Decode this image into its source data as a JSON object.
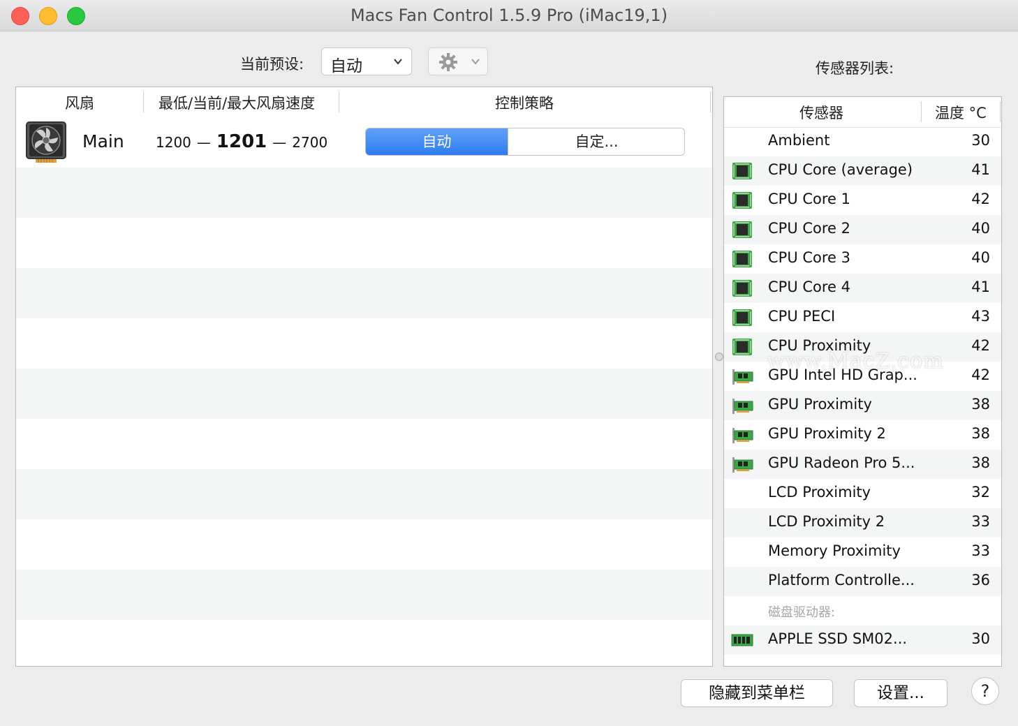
{
  "window": {
    "title": "Macs Fan Control 1.5.9 Pro (iMac19,1)"
  },
  "toolbar": {
    "preset_label": "当前预设:",
    "preset_value": "自动",
    "gear_icon": "gear-icon"
  },
  "fans": {
    "headers": {
      "fan": "风扇",
      "speed": "最低/当前/最大风扇速度",
      "control": "控制策略"
    },
    "rows": [
      {
        "icon": "fan-icon",
        "name": "Main",
        "min": "1200",
        "current": "1201",
        "max": "2700",
        "separator": "—",
        "control_auto": "自动",
        "control_custom": "自定...",
        "selected": "auto"
      }
    ]
  },
  "sensors": {
    "list_label": "传感器列表:",
    "headers": {
      "sensor": "传感器",
      "temp": "温度 °C"
    },
    "rows": [
      {
        "name": "Ambient",
        "temp": "30",
        "icon": "none"
      },
      {
        "name": "CPU Core (average)",
        "temp": "41",
        "icon": "chip-icon"
      },
      {
        "name": "CPU Core 1",
        "temp": "42",
        "icon": "chip-icon"
      },
      {
        "name": "CPU Core 2",
        "temp": "40",
        "icon": "chip-icon"
      },
      {
        "name": "CPU Core 3",
        "temp": "40",
        "icon": "chip-icon"
      },
      {
        "name": "CPU Core 4",
        "temp": "41",
        "icon": "chip-icon"
      },
      {
        "name": "CPU PECI",
        "temp": "43",
        "icon": "chip-icon"
      },
      {
        "name": "CPU Proximity",
        "temp": "42",
        "icon": "chip-icon"
      },
      {
        "name": "GPU Intel HD Grap...",
        "temp": "42",
        "icon": "gpu-card-icon"
      },
      {
        "name": "GPU Proximity",
        "temp": "38",
        "icon": "gpu-card-icon"
      },
      {
        "name": "GPU Proximity 2",
        "temp": "38",
        "icon": "gpu-card-icon"
      },
      {
        "name": "GPU Radeon Pro 5...",
        "temp": "38",
        "icon": "gpu-card-icon"
      },
      {
        "name": "LCD Proximity",
        "temp": "32",
        "icon": "none"
      },
      {
        "name": "LCD Proximity 2",
        "temp": "33",
        "icon": "none"
      },
      {
        "name": "Memory Proximity",
        "temp": "33",
        "icon": "none"
      },
      {
        "name": "Platform Controlle...",
        "temp": "36",
        "icon": "none"
      }
    ],
    "disk_group_label": "磁盘驱动器:",
    "disk_rows": [
      {
        "name": "APPLE SSD SM02...",
        "temp": "30",
        "icon": "ssd-icon"
      }
    ]
  },
  "watermark": "www.MacZ.com",
  "buttons": {
    "hide_to_menubar": "隐藏到菜单栏",
    "settings": "设置...",
    "help": "?"
  },
  "colors": {
    "accent": "#2f7cf1",
    "chip_green": "#3aa845"
  }
}
